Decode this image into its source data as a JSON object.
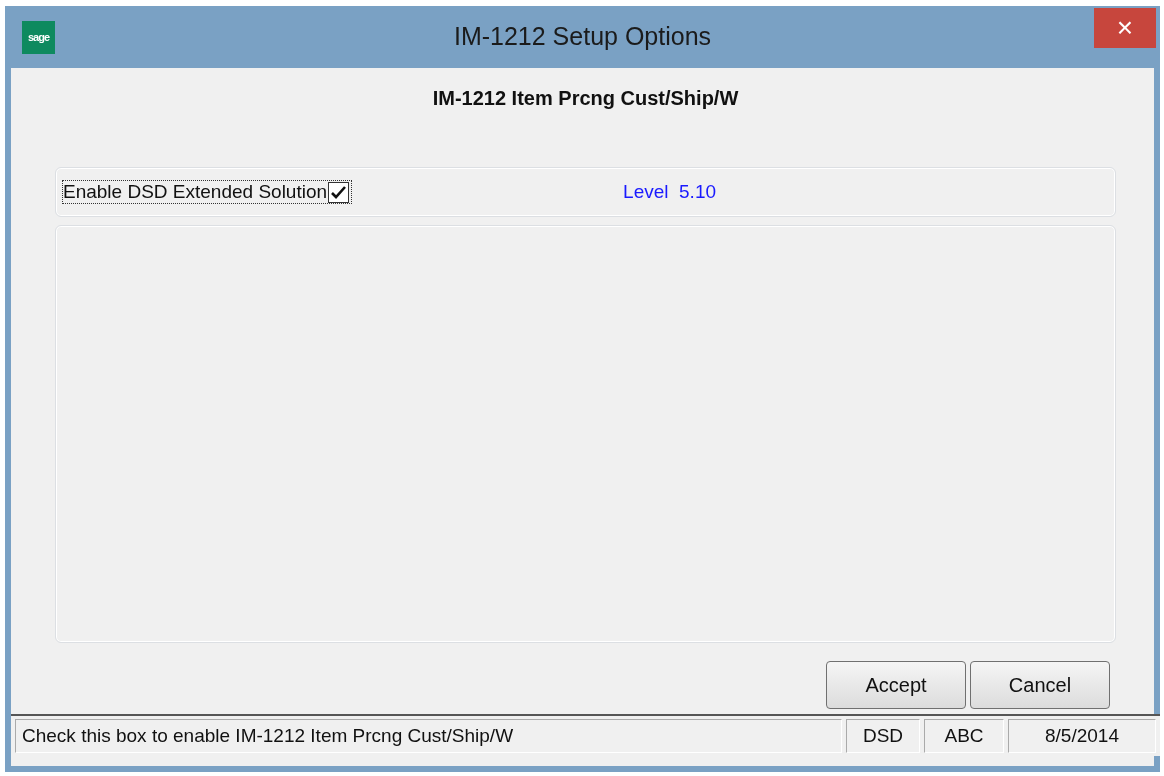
{
  "window": {
    "logo": "sage",
    "title": "IM-1212 Setup Options",
    "close": "×"
  },
  "heading": "IM-1212 Item Prcng Cust/Ship/W",
  "option": {
    "label": "Enable DSD Extended Solution",
    "checked": true,
    "level_text": "Level  5.10"
  },
  "buttons": [
    "Accept",
    "Cancel"
  ],
  "status_bar": {
    "message": "Check this box to enable IM-1212 Item Prcng Cust/Ship/W",
    "panels": [
      "DSD",
      "ABC",
      "8/5/2014"
    ]
  }
}
